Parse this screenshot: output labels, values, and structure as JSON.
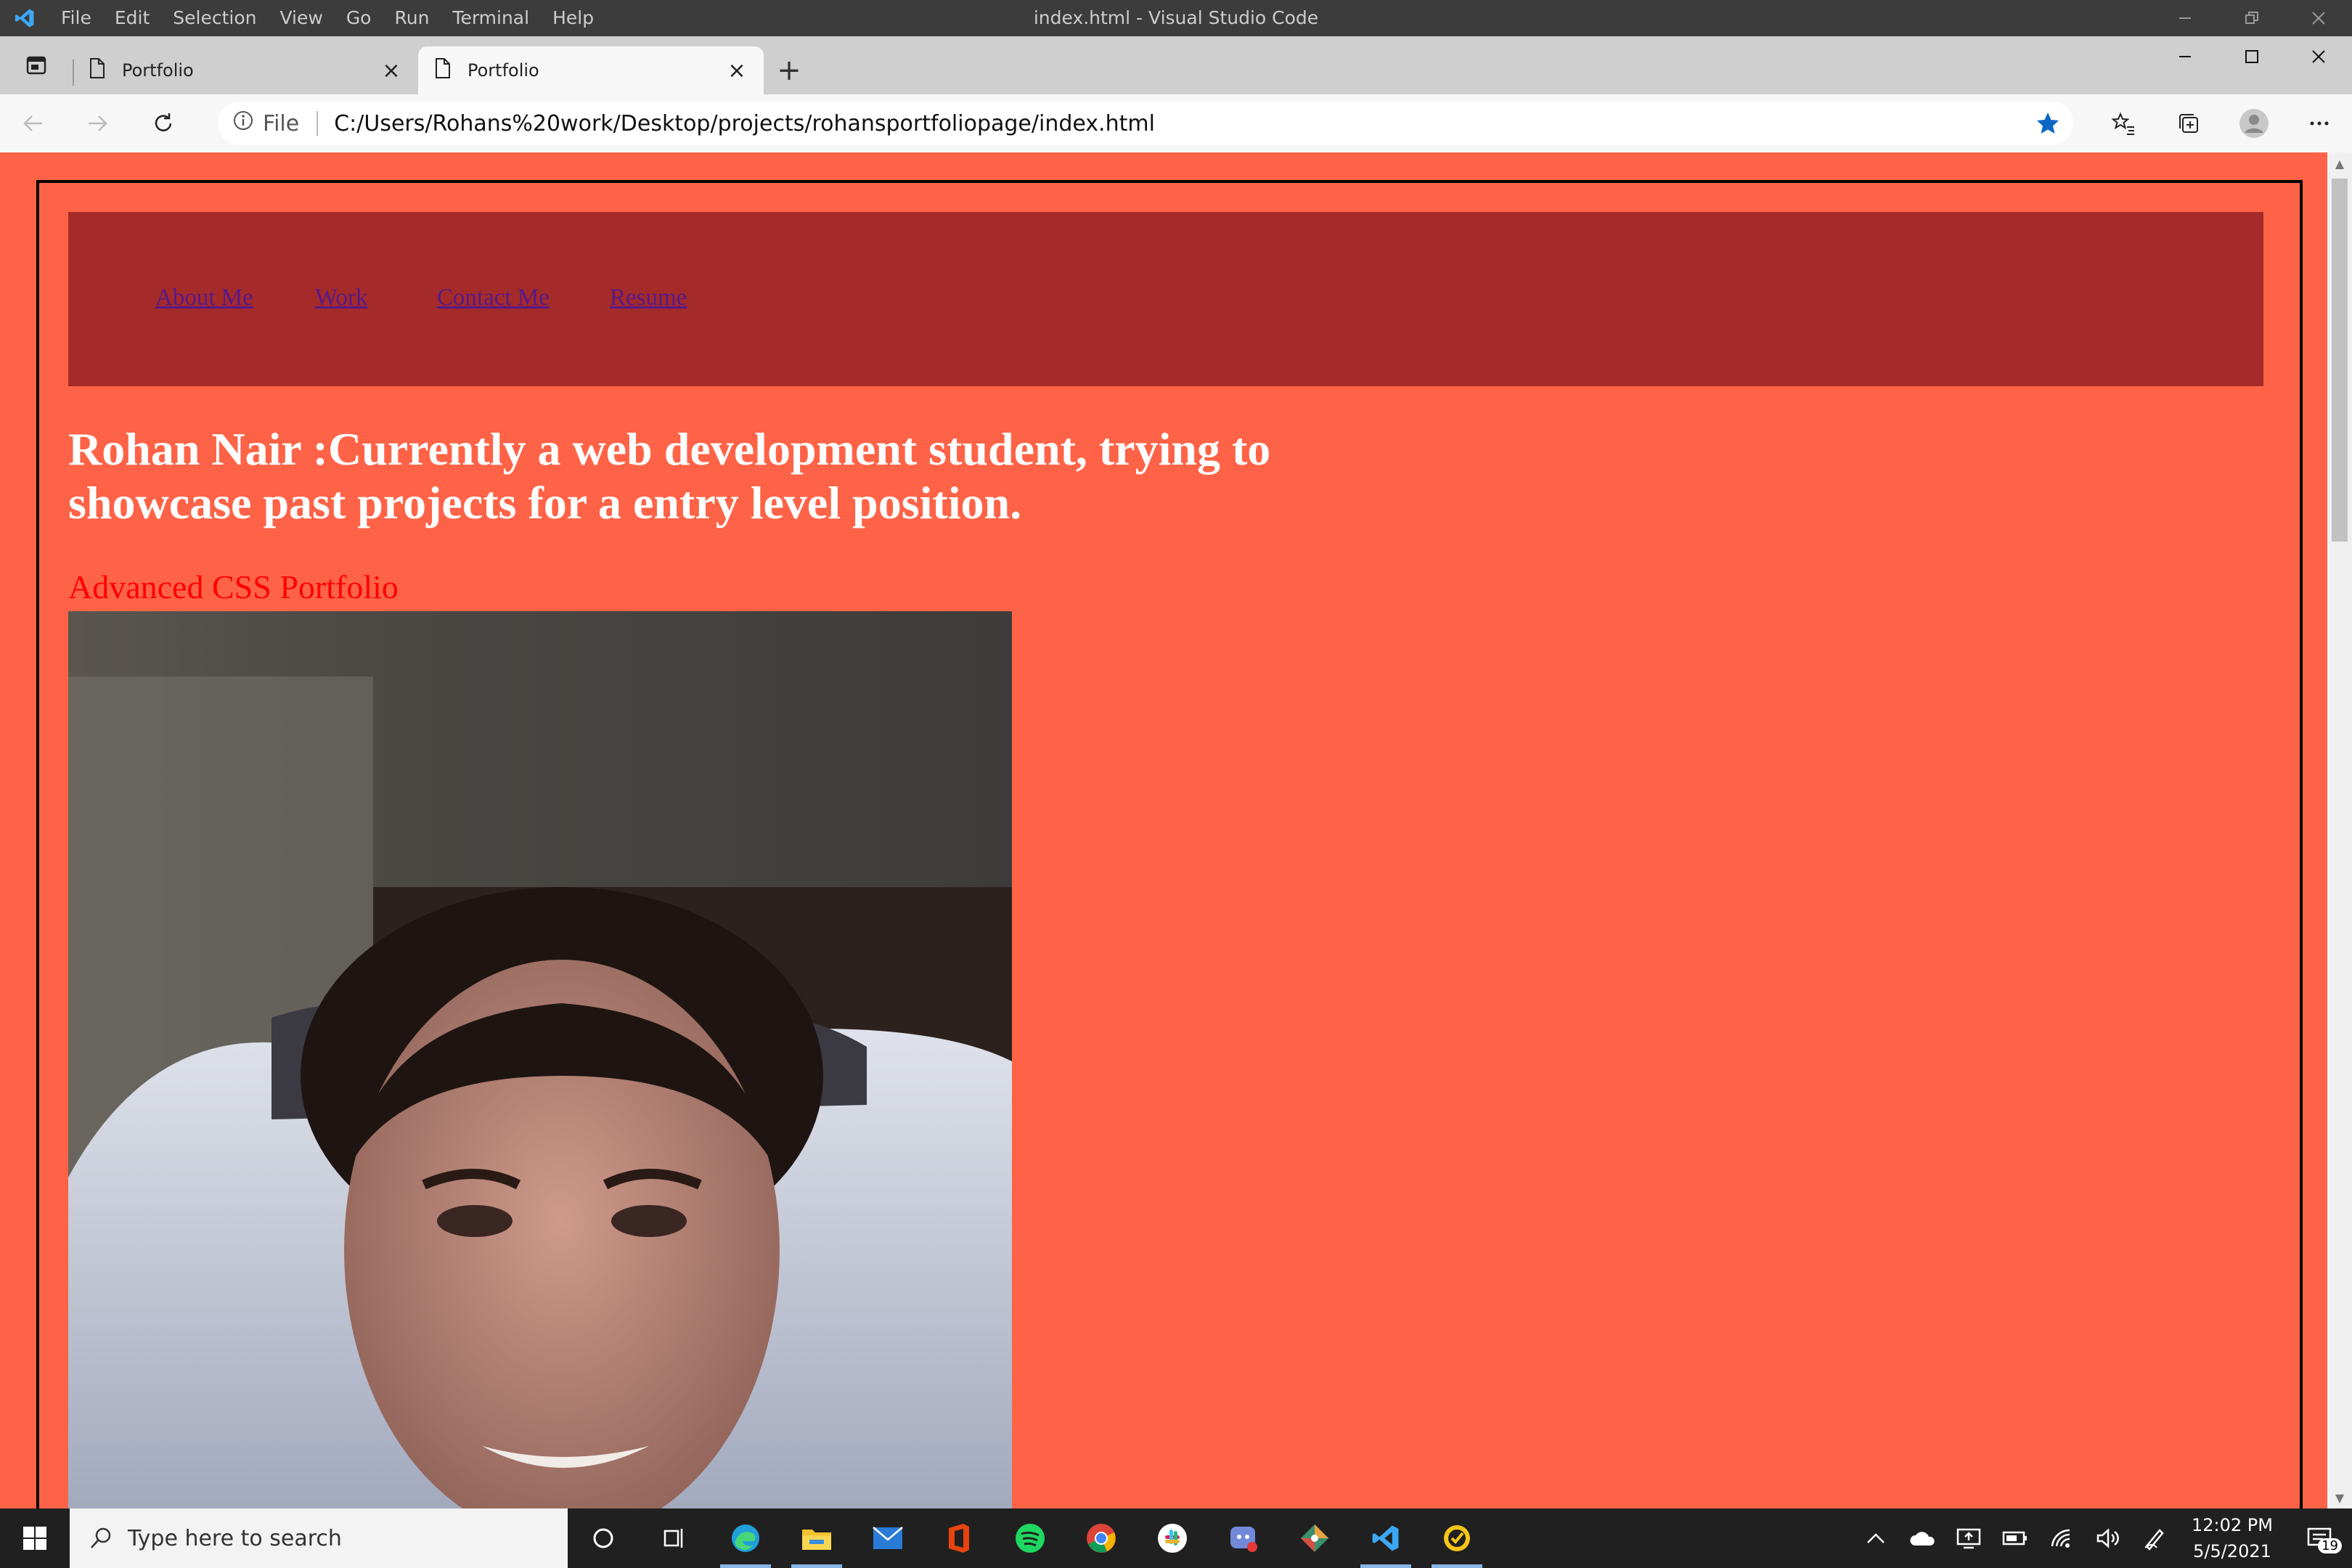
{
  "vscode": {
    "menu": [
      "File",
      "Edit",
      "Selection",
      "View",
      "Go",
      "Run",
      "Terminal",
      "Help"
    ],
    "title": "index.html - Visual Studio Code"
  },
  "browser": {
    "tabs": [
      {
        "title": "Portfolio",
        "active": false
      },
      {
        "title": "Portfolio",
        "active": true
      }
    ],
    "address": {
      "scheme_label": "File",
      "url": "C:/Users/Rohans%20work/Desktop/projects/rohansportfoliopage/index.html"
    },
    "colors": {
      "favorite_star": "#0a66c2"
    }
  },
  "page": {
    "nav": [
      "About Me",
      "Work",
      "Contact Me",
      "Resume"
    ],
    "headline": "Rohan Nair :Currently a web development student, trying to showcase past projects for a entry level position.",
    "subhead": "Advanced CSS Portfolio",
    "colors": {
      "background": "#ff6347",
      "navbar": "#a52a2a",
      "subhead": "#ff0000",
      "link": "#551a8b"
    }
  },
  "taskbar": {
    "search_placeholder": "Type here to search",
    "clock": {
      "time": "12:02 PM",
      "date": "5/5/2021"
    },
    "notifications": "19",
    "apps": [
      "cortana-icon",
      "task-view-icon",
      "edge-icon",
      "file-explorer-icon",
      "mail-icon",
      "office-icon",
      "spotify-icon",
      "chrome-icon",
      "slack-icon",
      "discord-icon",
      "git-icon",
      "vscode-icon",
      "norton-icon"
    ]
  }
}
